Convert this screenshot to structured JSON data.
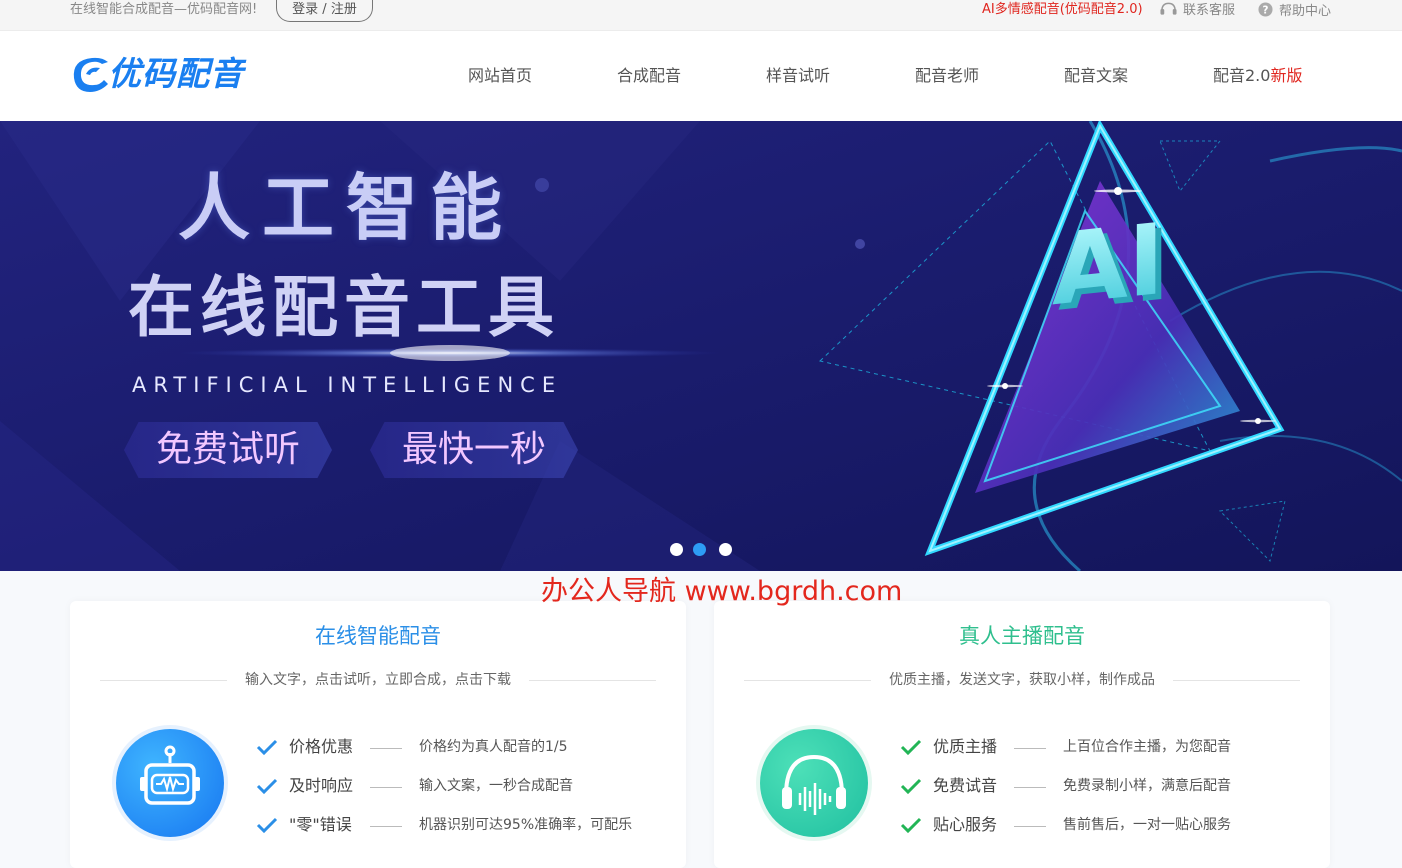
{
  "topbar": {
    "slogan": "在线智能合成配音—优码配音网!",
    "login": "登录 / 注册",
    "ai_link": "AI多情感配音(优码配音2.0)",
    "service": "联系客服",
    "help": "帮助中心"
  },
  "logo": {
    "text": "优码配音"
  },
  "nav": [
    {
      "label": "网站首页"
    },
    {
      "label": "合成配音"
    },
    {
      "label": "样音试听"
    },
    {
      "label": "配音老师"
    },
    {
      "label": "配音文案"
    },
    {
      "label": "配音2.0",
      "badge": "新版"
    }
  ],
  "banner": {
    "title1": "人工智能",
    "title2": "在线配音工具",
    "subtitle": "ARTIFICIAL INTELLIGENCE",
    "btn1": "免费试听",
    "btn2": "最快一秒",
    "ai_text": "AI",
    "slides": 3,
    "active_slide": 2
  },
  "watermark": "办公人导航 www.bgrdh.com",
  "cards": [
    {
      "title": "在线智能配音",
      "subtitle": "输入文字，点击试听，立即合成，点击下载",
      "icon": "robot-icon",
      "color": "#2b8fe7",
      "features": [
        {
          "name": "价格优惠",
          "desc": "价格约为真人配音的1/5"
        },
        {
          "name": "及时响应",
          "desc": "输入文案，一秒合成配音"
        },
        {
          "name": "\"零\"错误",
          "desc": "机器识别可达95%准确率，可配乐"
        }
      ]
    },
    {
      "title": "真人主播配音",
      "subtitle": "优质主播，发送文字，获取小样，制作成品",
      "icon": "headphones-icon",
      "color": "#2fbf8e",
      "features": [
        {
          "name": "优质主播",
          "desc": "上百位合作主播，为您配音"
        },
        {
          "name": "免费试音",
          "desc": "免费录制小样，满意后配音"
        },
        {
          "name": "贴心服务",
          "desc": "售前售后，一对一贴心服务"
        }
      ]
    }
  ]
}
